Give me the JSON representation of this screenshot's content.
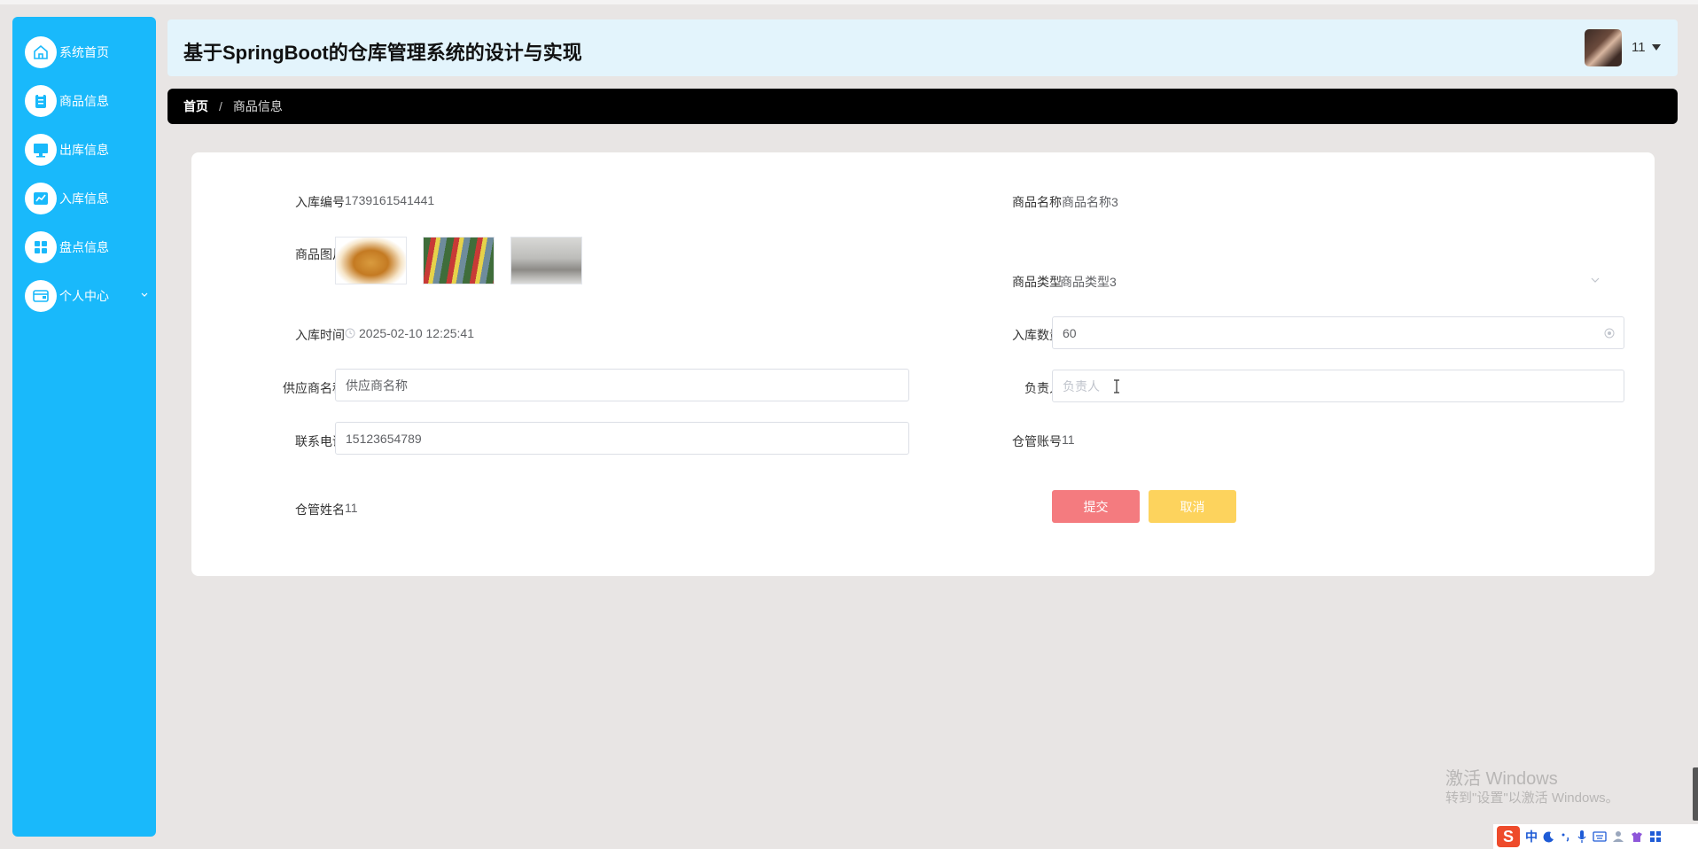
{
  "header": {
    "title": "基于SpringBoot的仓库管理系统的设计与实现",
    "user_name": "11"
  },
  "sidebar": {
    "items": [
      {
        "label": "系统首页",
        "icon": "home-icon"
      },
      {
        "label": "商品信息",
        "icon": "clipboard-icon"
      },
      {
        "label": "出库信息",
        "icon": "monitor-icon"
      },
      {
        "label": "入库信息",
        "icon": "chart-icon"
      },
      {
        "label": "盘点信息",
        "icon": "grid-icon"
      },
      {
        "label": "个人中心",
        "icon": "wallet-icon"
      }
    ]
  },
  "breadcrumb": {
    "home": "首页",
    "separator": "/",
    "current": "商品信息"
  },
  "form": {
    "inbound_no_label": "入库编号",
    "inbound_no_value": "1739161541441",
    "product_name_label": "商品名称",
    "product_name_value": "商品名称3",
    "product_image_label": "商品图片",
    "product_type_label": "商品类型",
    "product_type_value": "商品类型3",
    "inbound_time_label": "入库时间",
    "inbound_time_value": "2025-02-10 12:25:41",
    "inbound_qty_label": "入库数量",
    "inbound_qty_value": "60",
    "supplier_label": "供应商名称",
    "supplier_placeholder": "供应商名称",
    "manager_label": "负责人",
    "manager_placeholder": "负责人",
    "phone_label": "联系电话",
    "phone_value": "15123654789",
    "keeper_account_label": "仓管账号",
    "keeper_account_value": "11",
    "keeper_name_label": "仓管姓名",
    "keeper_name_value": "11",
    "submit_label": "提交",
    "cancel_label": "取消"
  },
  "watermark": {
    "line1": "激活 Windows",
    "line2": "转到\"设置\"以激活 Windows。"
  },
  "ime": {
    "logo": "S",
    "mode": "中"
  },
  "colors": {
    "sidebar": "#19b9fb",
    "header": "#e3f4fc",
    "breadcrumb": "#000000",
    "submit": "#f47b7f",
    "cancel": "#fdd35d"
  }
}
